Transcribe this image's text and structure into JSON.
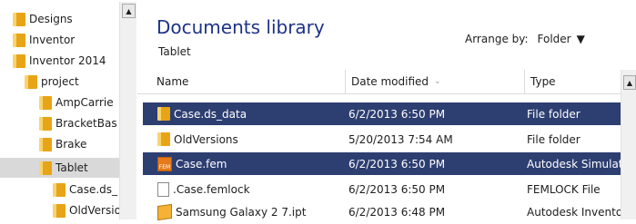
{
  "nav": {
    "items": [
      {
        "label": "Designs"
      },
      {
        "label": "Inventor"
      },
      {
        "label": "Inventor 2014"
      },
      {
        "label": "project"
      },
      {
        "label": "AmpCarrie"
      },
      {
        "label": "BracketBas"
      },
      {
        "label": "Brake"
      },
      {
        "label": "Tablet"
      },
      {
        "label": "Case.ds_"
      },
      {
        "label": "OldVersio"
      }
    ],
    "scroll_up": "▲"
  },
  "library": {
    "title": "Documents library",
    "subtitle": "Tablet",
    "arrange_label": "Arrange by:",
    "arrange_value": "Folder",
    "arrange_caret": "▼"
  },
  "columns": {
    "name": "Name",
    "date": "Date modified",
    "type": "Type",
    "sort_arrow": "⌄"
  },
  "files": [
    {
      "name": "Case.ds_data",
      "date": "6/2/2013 6:50 PM",
      "type": "File folder",
      "icon": "folder-icon"
    },
    {
      "name": "OldVersions",
      "date": "5/20/2013 7:54 AM",
      "type": "File folder",
      "icon": "folder-icon"
    },
    {
      "name": "Case.fem",
      "date": "6/2/2013 6:50 PM",
      "type": "Autodesk Simulat",
      "icon": "fem-file-icon",
      "fem_badge": "FEM"
    },
    {
      "name": ".Case.femlock",
      "date": "6/2/2013 6:50 PM",
      "type": "FEMLOCK File",
      "icon": "blank-file-icon"
    },
    {
      "name": "Samsung Galaxy 2 7.ipt",
      "date": "6/2/2013 6:48 PM",
      "type": "Autodesk Invento",
      "icon": "part-file-icon"
    }
  ],
  "main_scroll_up": "▲",
  "colors": {
    "selection": "#2d3e71",
    "title": "#1e3287",
    "folder": "#e8a417"
  }
}
